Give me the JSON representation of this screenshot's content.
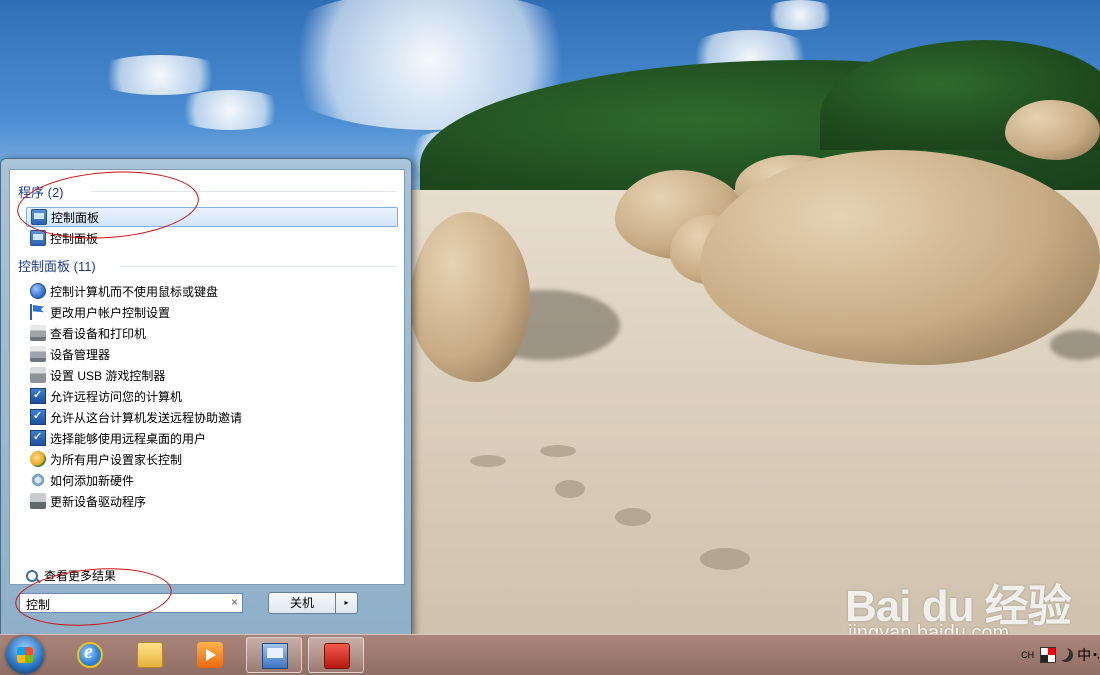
{
  "start_menu": {
    "groups": [
      {
        "title": "程序 (2)",
        "items": [
          {
            "label": "控制面板",
            "icon": "control-panel-icon",
            "selected": true
          },
          {
            "label": "控制面板",
            "icon": "control-panel-icon",
            "selected": false
          }
        ]
      },
      {
        "title": "控制面板 (11)",
        "items": [
          {
            "label": "控制计算机而不使用鼠标或键盘",
            "icon": "ease-of-access-icon"
          },
          {
            "label": "更改用户帐户控制设置",
            "icon": "uac-flag-icon"
          },
          {
            "label": "查看设备和打印机",
            "icon": "printer-icon"
          },
          {
            "label": "设备管理器",
            "icon": "device-manager-icon"
          },
          {
            "label": "设置 USB 游戏控制器",
            "icon": "game-controller-icon"
          },
          {
            "label": "允许远程访问您的计算机",
            "icon": "remote-access-icon"
          },
          {
            "label": "允许从这台计算机发送远程协助邀请",
            "icon": "remote-assistance-icon"
          },
          {
            "label": "选择能够使用远程桌面的用户",
            "icon": "remote-desktop-icon"
          },
          {
            "label": "为所有用户设置家长控制",
            "icon": "parental-controls-icon"
          },
          {
            "label": "如何添加新硬件",
            "icon": "add-hardware-icon"
          },
          {
            "label": "更新设备驱动程序",
            "icon": "driver-update-icon"
          }
        ]
      }
    ],
    "see_more": "查看更多结果",
    "search": {
      "value": "控制",
      "clear_glyph": "×"
    },
    "shutdown": {
      "label": "关机",
      "arrow": "▸"
    }
  },
  "taskbar": {
    "tray": {
      "lang": "CH",
      "ime_text": "中",
      "punct": "•,"
    }
  },
  "watermark": {
    "brand": "Bai du 经验",
    "url": "jingyan.baidu.com"
  },
  "colors": {
    "annotation": "#d01010",
    "group_title": "#1e3d8a",
    "taskbar": "#a5807a"
  }
}
